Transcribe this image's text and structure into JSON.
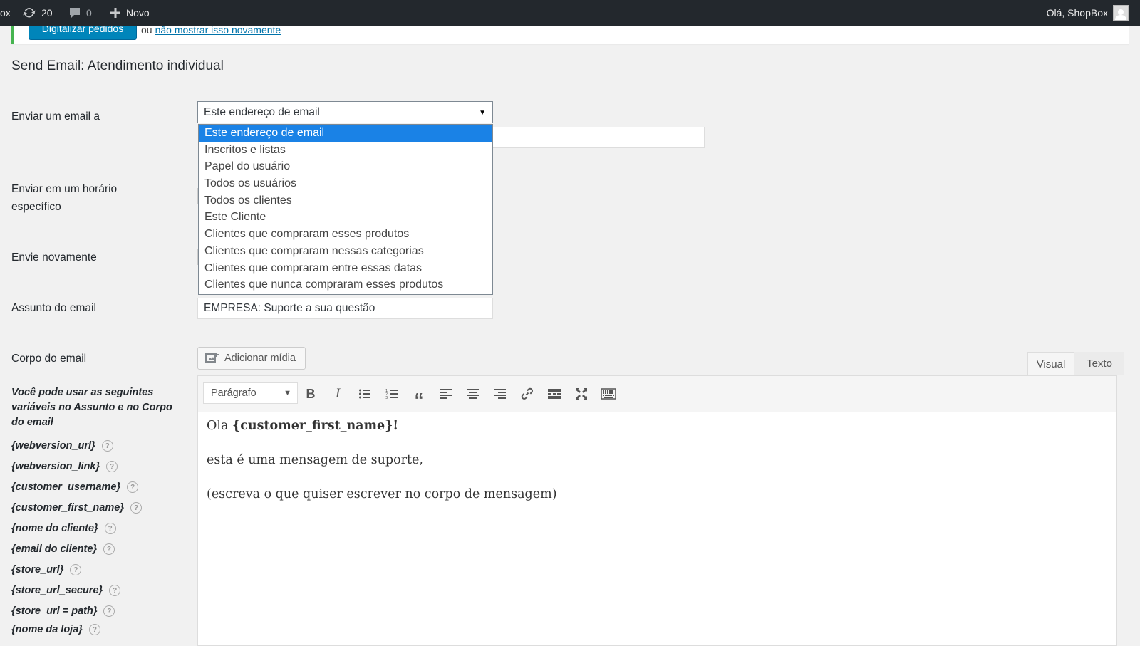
{
  "adminbar": {
    "site_fragment": "ox",
    "updates_count": "20",
    "comments_count": "0",
    "new_label": "Novo",
    "greeting": "Olá, ShopBox"
  },
  "notice": {
    "button_label": "Digitalizar pedidos",
    "text": "ou",
    "link": "não mostrar isso novamente"
  },
  "page_title": "Send Email: Atendimento individual",
  "labels": {
    "send_to": "Enviar um email a",
    "send_time_line1": "Enviar em um horário",
    "send_time_line2": "específico",
    "resend": "Envie novamente",
    "subject": "Assunto do email",
    "body": "Corpo do email"
  },
  "send_to_select": {
    "value": "Este endereço de email",
    "options": [
      "Este endereço de email",
      "Inscritos e listas",
      "Papel do usuário",
      "Todos os usuários",
      "Todos os clientes",
      "Este Cliente",
      "Clientes que compraram esses produtos",
      "Clientes que compraram nessas categorias",
      "Clientes que compraram entre essas datas",
      "Clientes que nunca compraram esses produtos"
    ]
  },
  "subject_value": "EMPRESA: Suporte a sua questão",
  "media_button": "Adicionar mídia",
  "editor_tabs": {
    "visual": "Visual",
    "text": "Texto"
  },
  "format_select": "Parágrafo",
  "editor_content": {
    "line1_prefix": "Ola ",
    "line1_bold": "{customer_first_name}!",
    "line2": "esta é uma mensagem de suporte,",
    "line3": "(escreva o que quiser escrever no corpo de mensagem)"
  },
  "help_text": "Você pode usar as seguintes variáveis no Assunto e no Corpo do email",
  "variables": [
    "{webversion_url}",
    "{webversion_link}",
    "{customer_username}",
    "{customer_first_name}",
    "{nome do cliente}",
    "{email do cliente}",
    "{store_url}",
    "{store_url_secure}",
    "{store_url = path}",
    "{nome da loja}"
  ],
  "colors": {
    "adminbar": "#23282d",
    "primary_button": "#0085ba",
    "selected_option": "#1a82e6",
    "notice_border": "#46b450"
  }
}
